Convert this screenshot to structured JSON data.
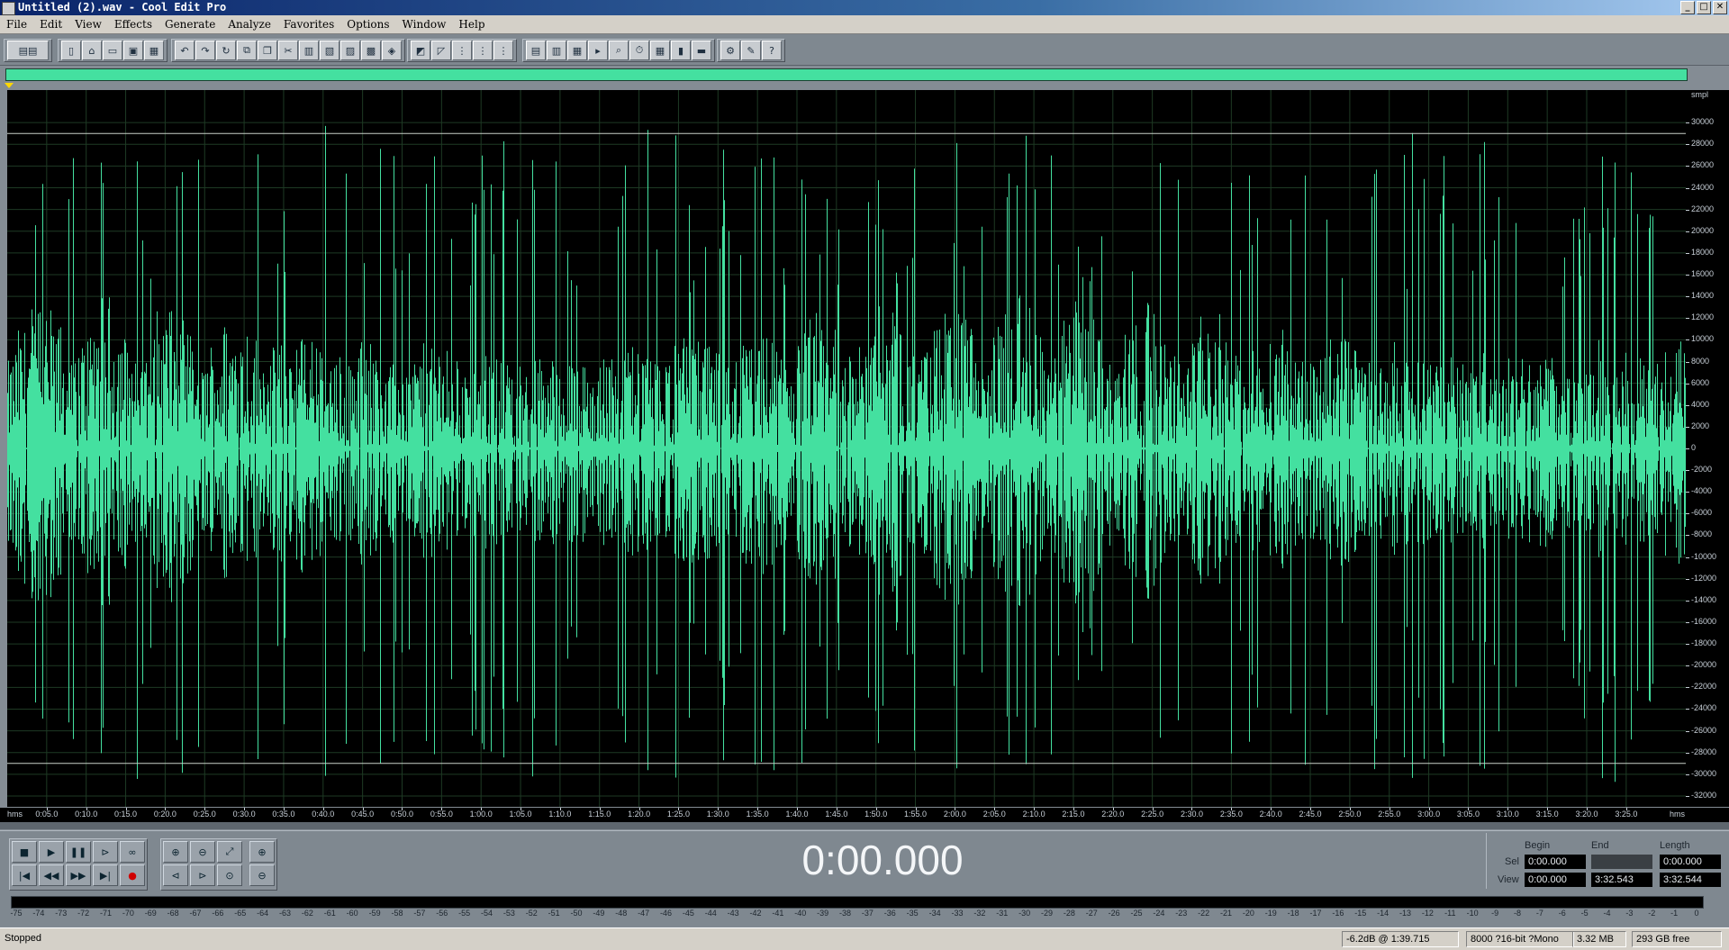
{
  "window": {
    "title": "Untitled (2).wav - Cool Edit Pro",
    "controls": [
      "_",
      "□",
      "✕"
    ]
  },
  "menu": [
    "File",
    "Edit",
    "View",
    "Effects",
    "Generate",
    "Analyze",
    "Favorites",
    "Options",
    "Window",
    "Help"
  ],
  "toolbar": {
    "groups": [
      [
        "mode-switch-icon"
      ],
      [
        "new-file-icon",
        "open-file-icon",
        "close-file-icon",
        "save-icon",
        "save-all-icon"
      ],
      [
        "undo-icon",
        "redo-icon",
        "repeat-icon",
        "copy-icon",
        "copy-to-new-icon",
        "cut-icon",
        "paste-icon",
        "paste-to-new-icon",
        "mix-paste-icon",
        "trim-icon",
        "select-all-icon"
      ],
      [
        "spectral-view-icon",
        "envelope-icon",
        "snap-icon",
        "snap-ruler-icon",
        "snap-frames-icon"
      ],
      [
        "cd-player-icon",
        "waveform-view-icon",
        "scripts-icon",
        "play-looped-icon",
        "zoom-icon",
        "time-format-icon",
        "frame-icon",
        "level-icon",
        "amplitude-icon"
      ],
      [
        "settings-icon",
        "tools-icon",
        "help-icon"
      ]
    ]
  },
  "overview": {
    "color": "#44e0a0"
  },
  "waveform": {
    "color": "#44e0a0",
    "background": "#000000",
    "grid_color": "#1e3a24",
    "zero_line_color": "#607068",
    "clip_lines": [
      29000,
      -29000
    ],
    "range": [
      -33000,
      33000
    ]
  },
  "amplitude_scale": {
    "unit": "smpl",
    "ticks": [
      30000,
      28000,
      26000,
      24000,
      22000,
      20000,
      18000,
      16000,
      14000,
      12000,
      10000,
      8000,
      6000,
      4000,
      2000,
      0,
      -2000,
      -4000,
      -6000,
      -8000,
      -10000,
      -12000,
      -14000,
      -16000,
      -18000,
      -20000,
      -22000,
      -24000,
      -26000,
      -28000,
      -30000,
      -32000
    ],
    "labels": [
      "30000",
      "28000",
      "26000",
      "24000",
      "22000",
      "20000",
      "18000",
      "16000",
      "14000",
      "12000",
      "10000",
      "8000",
      "6000",
      "4000",
      "2000",
      "0",
      "-2000",
      "-4000",
      "-6000",
      "-8000",
      "-10000",
      "-12000",
      "-14000",
      "-16000",
      "-18000",
      "-20000",
      "-22000",
      "-24000",
      "-26000",
      "-28000",
      "-30000",
      "-32000"
    ]
  },
  "time_ruler": {
    "unit": "hms",
    "duration_seconds": 212.544,
    "labels": [
      "0:05.0",
      "0:10.0",
      "0:15.0",
      "0:20.0",
      "0:25.0",
      "0:30.0",
      "0:35.0",
      "0:40.0",
      "0:45.0",
      "0:50.0",
      "0:55.0",
      "1:00.0",
      "1:05.0",
      "1:10.0",
      "1:15.0",
      "1:20.0",
      "1:25.0",
      "1:30.0",
      "1:35.0",
      "1:40.0",
      "1:45.0",
      "1:50.0",
      "1:55.0",
      "2:00.0",
      "2:05.0",
      "2:10.0",
      "2:15.0",
      "2:20.0",
      "2:25.0",
      "2:30.0",
      "2:35.0",
      "2:40.0",
      "2:45.0",
      "2:50.0",
      "2:55.0",
      "3:00.0",
      "3:05.0",
      "3:10.0",
      "3:15.0",
      "3:20.0",
      "3:25.0"
    ]
  },
  "transport": {
    "row1": [
      {
        "name": "stop-button",
        "icon": "■"
      },
      {
        "name": "play-button",
        "icon": "▶"
      },
      {
        "name": "pause-button",
        "icon": "❚❚"
      },
      {
        "name": "play-to-end-button",
        "icon": "⊳"
      },
      {
        "name": "loop-button",
        "icon": "∞"
      }
    ],
    "row2": [
      {
        "name": "go-to-start-button",
        "icon": "|◀"
      },
      {
        "name": "rewind-button",
        "icon": "◀◀"
      },
      {
        "name": "fast-forward-button",
        "icon": "▶▶"
      },
      {
        "name": "go-to-end-button",
        "icon": "▶|"
      },
      {
        "name": "record-button",
        "icon": "●"
      }
    ],
    "zoom_row1": [
      {
        "name": "zoom-in-button",
        "icon": "⊕"
      },
      {
        "name": "zoom-out-button",
        "icon": "⊖"
      },
      {
        "name": "zoom-full-button",
        "icon": "⤢"
      },
      {
        "name": "zoom-vertical-in-button",
        "icon": "⊕"
      }
    ],
    "zoom_row2": [
      {
        "name": "zoom-to-left-button",
        "icon": "⊲"
      },
      {
        "name": "zoom-to-right-button",
        "icon": "⊳"
      },
      {
        "name": "zoom-selection-button",
        "icon": "⊙"
      },
      {
        "name": "zoom-vertical-out-button",
        "icon": "⊖"
      }
    ]
  },
  "time_display": "0:00.000",
  "selection": {
    "headers": {
      "begin": "Begin",
      "end": "End",
      "length": "Length"
    },
    "sel": {
      "label": "Sel",
      "begin": "0:00.000",
      "end": "",
      "length": "0:00.000"
    },
    "view": {
      "label": "View",
      "begin": "0:00.000",
      "end": "3:32.543",
      "length": "3:32.544"
    }
  },
  "levels": {
    "labels": [
      "-75",
      "-74",
      "-73",
      "-72",
      "-71",
      "-70",
      "-69",
      "-68",
      "-67",
      "-66",
      "-65",
      "-64",
      "-63",
      "-62",
      "-61",
      "-60",
      "-59",
      "-58",
      "-57",
      "-56",
      "-55",
      "-54",
      "-53",
      "-52",
      "-51",
      "-50",
      "-49",
      "-48",
      "-47",
      "-46",
      "-45",
      "-44",
      "-43",
      "-42",
      "-41",
      "-40",
      "-39",
      "-38",
      "-37",
      "-36",
      "-35",
      "-34",
      "-33",
      "-32",
      "-31",
      "-30",
      "-29",
      "-28",
      "-27",
      "-26",
      "-25",
      "-24",
      "-23",
      "-22",
      "-21",
      "-20",
      "-19",
      "-18",
      "-17",
      "-16",
      "-15",
      "-14",
      "-13",
      "-12",
      "-11",
      "-10",
      "-9",
      "-8",
      "-7",
      "-6",
      "-5",
      "-4",
      "-3",
      "-2",
      "-1",
      "0"
    ]
  },
  "status": {
    "state": "Stopped",
    "level": "-6.2dB @  1:39.715",
    "format": "8000 ?16-bit ?Mono",
    "size": "3.32 MB",
    "free": "293 GB free"
  }
}
